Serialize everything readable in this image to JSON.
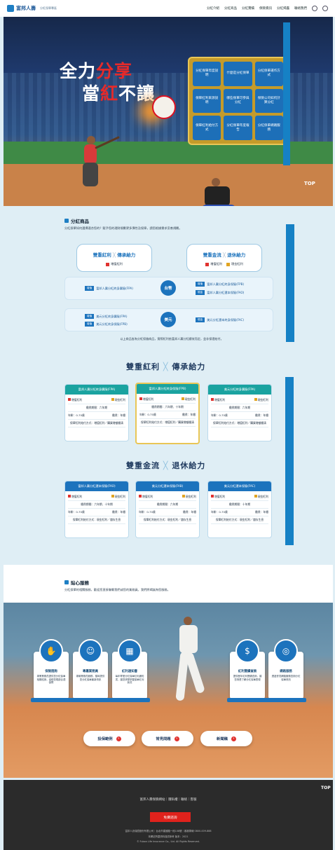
{
  "header": {
    "logo_text": "富邦人壽",
    "logo_sub": "分紅保單專區",
    "nav": [
      "分紅介紹",
      "分紅商品",
      "分紅實績",
      "保險資訊",
      "分紅揭露",
      "聯絡我們"
    ]
  },
  "hero": {
    "title_a": "全力",
    "title_b": "分享",
    "title_c": "當",
    "title_d": "紅",
    "title_e": "不讓",
    "grid": [
      "分紅保單年度說明",
      "什麼是分紅保單",
      "分紅保單運作方式",
      "保單紅利來源說明",
      "哪些保單可參與分紅",
      "保險公司如何計算分紅",
      "保單紅利給付方式",
      "分紅保單年度報告",
      "分紅保單網路服務"
    ],
    "top_btn": "TOP"
  },
  "products": {
    "title": "分紅商品",
    "desc": "分紅保單如何選擇適合您的？賦予您的理財規劃更多彈性及保障，請您根據需求妥善規劃。",
    "left_box": {
      "t1": "雙重紅利",
      "x": "╳",
      "t2": "傳承給力",
      "tag": "增值紅利"
    },
    "right_box": {
      "t1": "雙重金流",
      "x": "╳",
      "t2": "退休給力",
      "tags": [
        "增值紅利",
        "現金紅利"
      ]
    },
    "circle_top": "台幣",
    "circle_bottom": "美元",
    "row_a": {
      "badge": "增值",
      "text": "富邦人壽分紅終身壽險(FPA)"
    },
    "row_b": [
      {
        "badge": "增值",
        "text": "富邦人壽分紅終身保險(FPB)"
      },
      {
        "badge": "現金",
        "text": "富邦人壽分紅還本保險(FAO)"
      }
    ],
    "row_c": [
      {
        "badge": "增值",
        "text": "美元分紅終身壽險(FPA)"
      },
      {
        "badge": "增值",
        "text": "美元分紅終身保險(FPB)"
      }
    ],
    "row_d": {
      "badge": "現金",
      "text": "美元分紅還本終身保險(FAC)"
    },
    "note": "以上商品皆為分紅保險商品，實際紅利依富邦人壽分紅績效而定，並非保證給付。"
  },
  "group1": {
    "t1": "雙重紅利",
    "x": "╳",
    "t2": "傳承給力",
    "cards": [
      {
        "title": "富邦人壽分紅終身壽險(FPA)",
        "tags": [
          "增值紅利",
          "現金紅利"
        ],
        "line": "繳費期間：六年期",
        "left": "年齡：0-70歲",
        "right": "繳費：年繳",
        "foot": "保單紅利給付方式：增值紅利／購買增額繳清"
      },
      {
        "title": "富邦人壽分紅終身保險(FPB)",
        "tags": [
          "增值紅利",
          "現金紅利"
        ],
        "line": "繳費期間：六年期、十年期",
        "left": "年齡：0-70歲",
        "right": "繳費：年繳",
        "foot": "保單紅利給付方式：增值紅利／購買增額繳清"
      },
      {
        "title": "美元分紅終身壽險(FPA)",
        "tags": [
          "增值紅利",
          "現金紅利"
        ],
        "line": "繳費期間：六年期",
        "left": "年齡：0-70歲",
        "right": "繳費：年繳",
        "foot": "保單紅利給付方式：增值紅利／購買增額繳清"
      }
    ]
  },
  "group2": {
    "t1": "雙重金流",
    "x": "╳",
    "t2": "退休給力",
    "cards": [
      {
        "title": "富邦人壽分紅還本保險(FAO)",
        "tags": [
          "增值紅利",
          "現金紅利"
        ],
        "line": "繳費期間：六年期、十年期",
        "left": "年齡：0-70歲",
        "right": "繳費：年繳",
        "foot": "保單紅利給付方式：現金紅利／儲存生息"
      },
      {
        "title": "美元分紅還本保險(FAB)",
        "tags": [
          "增值紅利",
          "現金紅利"
        ],
        "line": "繳費期間：六年期",
        "left": "年齡：0-70歲",
        "right": "繳費：年繳",
        "foot": "保單紅利給付方式：現金紅利／儲存生息"
      },
      {
        "title": "美元分紅還本保險(FAC)",
        "tags": [
          "增值紅利",
          "現金紅利"
        ],
        "line": "繳費期間：十年期",
        "left": "年齡：0-70歲",
        "right": "繳費：年繳",
        "foot": "保單紅利給付方式：現金紅利／儲存生息"
      }
    ]
  },
  "service": {
    "title": "貼心服務",
    "desc": "分紅保單的相關服務，歡迎您直接聯繫我們或您的業務員，我們將竭誠為您服務。",
    "cards": [
      {
        "name": "保險諮詢",
        "text": "專業業務員提供您分紅保單相關諮詢，協助您規劃合適保障",
        "icon": "hand-coin-icon"
      },
      {
        "name": "專屬業務員",
        "text": "專屬業務員服務，隨時提供您分紅保單最新資訊",
        "icon": "agent-icon"
      },
      {
        "name": "紅利通知書",
        "text": "每年寄發分紅保單紅利通知書，讓您清楚掌握保單紅利狀況",
        "icon": "calendar-icon"
      },
      {
        "name": "紅利實績查詢",
        "text": "提供歷年紅利實績查詢，讓您清楚了解分紅保單表現",
        "icon": "money-icon"
      },
      {
        "name": "網路服務",
        "text": "透過會員網路服務查詢分紅保單資訊",
        "icon": "web-icon"
      }
    ],
    "pills": [
      {
        "label": "投保範例"
      },
      {
        "label": "常見問題"
      },
      {
        "label": "新聞稿"
      }
    ]
  },
  "footer": {
    "links": "富邦人壽保險網站｜隱私權｜聯絡｜客服",
    "button": "免費諮詢",
    "line1": "富邦人壽保險股份有限公司｜台北市建國路一段108號｜客服專線 0800-009-888",
    "line2": "本網站所載資料僅供參考 版本：2021",
    "line3": "© Fubon Life Insurance Co., Ltd. All Rights Reserved.",
    "top": "TOP"
  },
  "colors": {
    "accent": "#1c73bd",
    "red": "#e0322f",
    "teal": "#1aa3a0",
    "gold": "#c59b2a",
    "footer": "#2b2b2b"
  }
}
